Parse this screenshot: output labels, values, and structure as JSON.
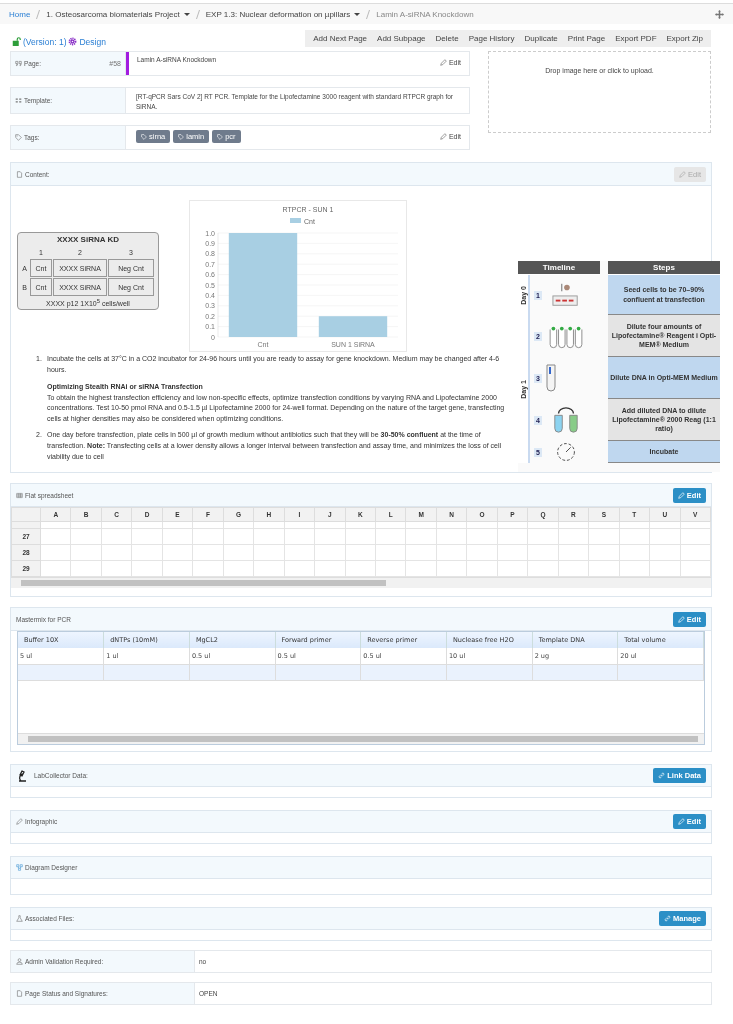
{
  "breadcrumb": [
    {
      "label": "Home",
      "kind": "link"
    },
    {
      "label": "1. Osteosarcoma biomaterials Project",
      "kind": "dropdown"
    },
    {
      "label": "EXP 1.3: Nuclear deformation on µpillars",
      "kind": "dropdown"
    },
    {
      "label": "Lamin A-siRNA Knockdown",
      "kind": "current"
    }
  ],
  "version": "(Version: 1)",
  "design": "Design",
  "toolbar": [
    "Add Next Page",
    "Add Subpage",
    "Delete",
    "Page History",
    "Duplicate",
    "Print Page",
    "Export PDF",
    "Export Zip"
  ],
  "page_info": {
    "label": "Page:",
    "number": "#58",
    "value": "Lamin A-siRNA Knockdown",
    "edit": "Edit"
  },
  "template_info": {
    "label": "Template:",
    "value": "[RT-qPCR Sars CoV 2] RT PCR. Template for the Lipofectamine 3000 reagent with standard RTPCR graph for SiRNA."
  },
  "tags_info": {
    "label": "Tags:",
    "tags": [
      "sirna",
      "lamin",
      "pcr"
    ],
    "edit": "Edit"
  },
  "dropzone": "Drop image here or click to upload.",
  "content": {
    "title": "Content:",
    "edit": {
      "label": "Edit",
      "disabled": true
    },
    "plate": {
      "title": "XXXX SiRNA KD",
      "columns": [
        "1",
        "2",
        "3"
      ],
      "rows": [
        {
          "label": "A",
          "cells": [
            "Cnt",
            "XXXX SiRNA",
            "Neg Cnt"
          ]
        },
        {
          "label": "B",
          "cells": [
            "Cnt",
            "XXXX SiRNA",
            "Neg Cnt"
          ]
        }
      ],
      "footer": "XXXX p12 1X10$^{5}$ cells/well"
    },
    "chart_data": {
      "type": "bar",
      "grid": true,
      "title": "RTPCR - SUN 1",
      "categories": [
        "Cnt",
        "SUN 1 SiRNA"
      ],
      "series": [
        {
          "name": "Cnt",
          "color": "#a8cfe3",
          "values": [
            1,
            0.2
          ]
        }
      ],
      "ylim": [
        0,
        1
      ],
      "yticks": [
        0,
        0.1,
        0.2,
        0.3,
        0.4,
        0.5,
        0.6,
        0.7,
        0.8,
        0.9,
        {
          "value": 1,
          "label": "1.0"
        }
      ]
    },
    "timeline": {
      "header": "Timeline",
      "steps_header": "Steps",
      "days": [
        {
          "label": "Day 0",
          "steps": [
            {
              "number": "1",
              "text": "Seed cells to be 70–90% confluent at transfection"
            }
          ]
        },
        {
          "label": "Day 1",
          "steps": [
            {
              "number": "2",
              "text": "Dilute four amounts of Lipofectamine® Reagent i Opti-MEM® Medium"
            },
            {
              "number": "3",
              "text": "Dilute DNA in Opti-MEM Medium"
            },
            {
              "number": "4",
              "text": "Add diluted DNA to dilute Lipofectamine® 2000 Reag (1:1 ratio)"
            },
            {
              "number": "5",
              "text": "Incubate"
            }
          ]
        }
      ]
    },
    "instructions": [
      {
        "number": "1.",
        "text": "Incubate the cells at 37°C in a CO2 incubator for 24-96 hours until you are ready to assay for gene knockdown. Medium may be changed after 4-6 hours.",
        "note_title": "Optimizing Stealth RNAi or siRNA Transfection",
        "note": "To obtain the highest transfection efficiency and low non-specific effects, optimize transfection conditions by varying RNA and Lipofectamine 2000 concentrations. Test 10-50 pmol RNA and 0.5-1.5 µl Lipofectamine 2000 for 24-well format. Depending on the nature of the target gene, transfecting cells at higher densities may also be considered when optimizing conditions."
      },
      {
        "number": "2.",
        "text": "One day before transfection, plate cells in 500 µl of growth medium without antibiotics such that they will be **30-50% confluent** at the time of transfection. **Note:** Transfecting cells at a lower density allows a longer interval between transfection and assay time, and minimizes the loss of cell viability due to cell"
      }
    ]
  },
  "spreadsheet": {
    "title": "Flat spreadsheet",
    "edit": "Edit",
    "columns": [
      "A",
      "B",
      "C",
      "D",
      "E",
      "F",
      "G",
      "H",
      "I",
      "J",
      "K",
      "L",
      "M",
      "N",
      "O",
      "P",
      "Q",
      "R",
      "S",
      "T",
      "U",
      "V"
    ],
    "rows": [
      "27",
      "28",
      "29"
    ]
  },
  "mastermix": {
    "title": "Mastermix for PCR",
    "edit": "Edit",
    "columns": [
      "Buffer 10X",
      "dNTPs (10mM)",
      "MgCL2",
      "Forward primer",
      "Reverse primer",
      "Nuclease free H2O",
      "Template DNA",
      "Total volume"
    ],
    "rows": [
      [
        "5 ul",
        "1 ul",
        "0.5 ul",
        "0.5 ul",
        "0.5 ul",
        "10 ul",
        "2 ug",
        "20 ul"
      ]
    ]
  },
  "labcollector": {
    "title": "LabCollector Data:",
    "button": "Link Data"
  },
  "infographic": {
    "title": "Infographic",
    "button": "Edit"
  },
  "diagram": {
    "title": "Diagram Designer"
  },
  "files": {
    "title": "Associated Files:",
    "button": "Manage"
  },
  "admin": {
    "label": "Admin Validation Required:",
    "value": "no"
  },
  "status": {
    "label": "Page Status and Signatures:",
    "value": "OPEN"
  }
}
